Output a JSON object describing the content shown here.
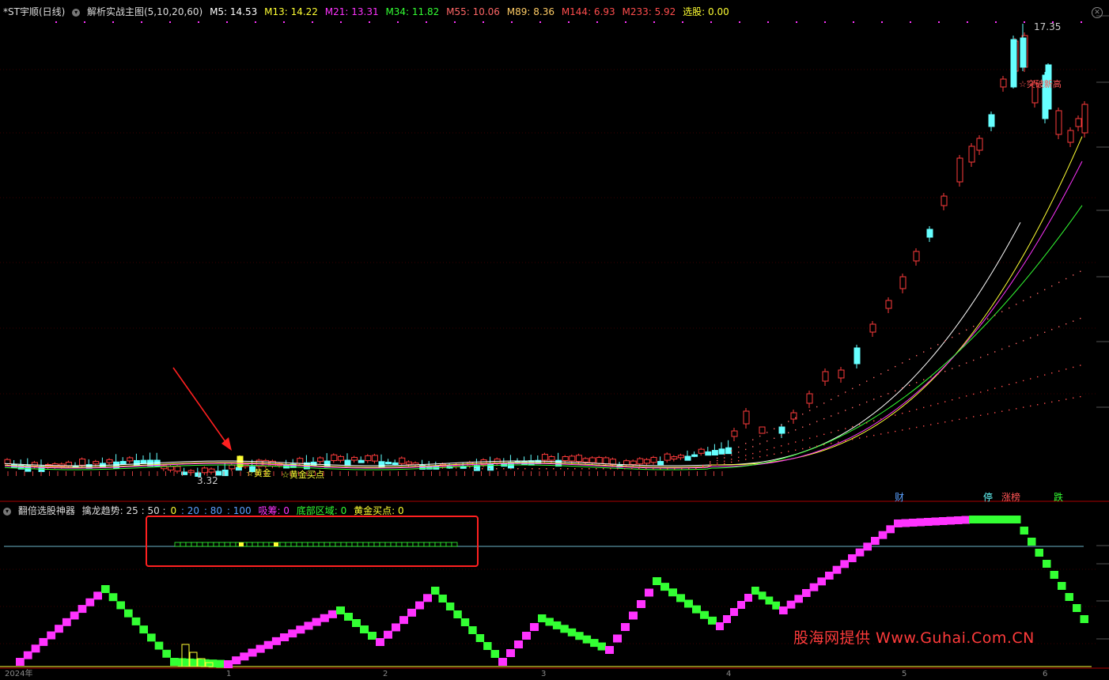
{
  "top_panel": {
    "stock_name": "*ST宇顺(日线)",
    "indicator_name": "解析实战主图(5,10,20,60)",
    "ma": [
      {
        "label": "M5: 14.53",
        "color": "#ffffff"
      },
      {
        "label": "M13: 14.22",
        "color": "#ffff33"
      },
      {
        "label": "M21: 13.31",
        "color": "#ff33ff"
      },
      {
        "label": "M34: 11.82",
        "color": "#33ff33"
      },
      {
        "label": "M55: 10.06",
        "color": "#ff6666"
      },
      {
        "label": "M89: 8.36",
        "color": "#ffcc66"
      },
      {
        "label": "M144: 6.93",
        "color": "#ff4d4d"
      },
      {
        "label": "M233: 5.92",
        "color": "#ff4d4d"
      },
      {
        "label": "选股: 0.00",
        "color": "#ffff33"
      }
    ],
    "price_high": "17.35",
    "price_low": "3.32",
    "annotations": {
      "gold1": "☆黄金",
      "gold2": "☆黄金买点",
      "break": "☆突破新高"
    }
  },
  "event_tags": [
    {
      "label": "财",
      "color": "#5aa0ff"
    },
    {
      "label": "停",
      "color": "#66ffff"
    },
    {
      "label": "涨榜",
      "color": "#ff5555"
    },
    {
      "label": "跌",
      "color": "#33ff33"
    }
  ],
  "bottom_panel": {
    "indicator_name": "翻倍选股神器",
    "trend_label": "擒龙趋势: 25 : 50 :",
    "v0": "0",
    "v20": ": 20",
    "v80": ": 80",
    "v100": ": 100",
    "absorb": "吸筹: 0",
    "bottom_zone": "底部区域: 0",
    "gold_buy": "黄金买点: 0"
  },
  "x_axis": {
    "labels": [
      "2024年",
      "1",
      "2",
      "3",
      "4",
      "5",
      "6"
    ]
  },
  "watermark": "股海网提供 Www.Guhai.Com.CN"
}
